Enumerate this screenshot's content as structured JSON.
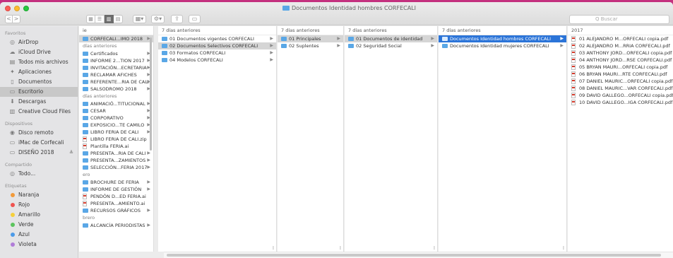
{
  "window": {
    "title": "Documentos Identidad hombres CORFECALI",
    "search_placeholder": "Q Buscar"
  },
  "toolbar": {
    "back_label": "<",
    "forward_label": ">",
    "view_icons": [
      "▦",
      "☰",
      "▥",
      "▤"
    ],
    "group_label": "▦▾",
    "action_label": "⚙▾",
    "share_label": "⇪",
    "tag_label": "▭"
  },
  "sidebar": {
    "favorites_header": "Favoritos",
    "favorites": [
      {
        "label": "AirDrop",
        "icon": "airdrop-icon",
        "glyph": "◎"
      },
      {
        "label": "iCloud Drive",
        "icon": "cloud-icon",
        "glyph": "☁"
      },
      {
        "label": "Todos mis archivos",
        "icon": "all-files-icon",
        "glyph": "▤"
      },
      {
        "label": "Aplicaciones",
        "icon": "applications-icon",
        "glyph": "✦"
      },
      {
        "label": "Documentos",
        "icon": "documents-icon",
        "glyph": "▯"
      },
      {
        "label": "Escritorio",
        "icon": "desktop-icon",
        "glyph": "▭",
        "selected": true
      },
      {
        "label": "Descargas",
        "icon": "downloads-icon",
        "glyph": "⬇"
      },
      {
        "label": "Creative Cloud Files",
        "icon": "creative-cloud-icon",
        "glyph": "▥"
      }
    ],
    "devices_header": "Dispositivos",
    "devices": [
      {
        "label": "Disco remoto",
        "icon": "remote-disc-icon",
        "glyph": "◉"
      },
      {
        "label": "iMac de Corfecali",
        "icon": "imac-icon",
        "glyph": "▭"
      },
      {
        "label": "DISEÑO 2018",
        "icon": "drive-icon",
        "glyph": "▭",
        "eject": "≜"
      }
    ],
    "shared_header": "Compartido",
    "shared": [
      {
        "label": "Todo...",
        "icon": "network-icon",
        "glyph": "◎"
      }
    ],
    "tags_header": "Etiquetas",
    "tags": [
      {
        "label": "Naranja",
        "color": "#f29a3a"
      },
      {
        "label": "Rojo",
        "color": "#ef5350"
      },
      {
        "label": "Amarillo",
        "color": "#f5cf3b"
      },
      {
        "label": "Verde",
        "color": "#5cc45e"
      },
      {
        "label": "Azul",
        "color": "#4c9ae8"
      },
      {
        "label": "Violeta",
        "color": "#b07cd8"
      }
    ]
  },
  "columns": {
    "c1": {
      "header": "ie",
      "groups": [
        {
          "header": "",
          "rows": [
            {
              "label": "CORFECALI...IMO 2018",
              "arrow": true,
              "icon": "folder",
              "selected": "gray"
            }
          ]
        },
        {
          "header": "días anteriores",
          "rows": [
            {
              "label": "Certificados",
              "arrow": true,
              "icon": "folder"
            },
            {
              "label": "INFORME 2...TION 2017",
              "arrow": true,
              "icon": "folder"
            },
            {
              "label": "INVITACIÓN...ECRETARIA",
              "arrow": true,
              "icon": "folder"
            },
            {
              "label": "RECLAMAR AFICHES",
              "arrow": true,
              "icon": "folder"
            },
            {
              "label": "REFERENTE...RIA DE CALI",
              "arrow": true,
              "icon": "folder"
            },
            {
              "label": "SALSODROMO 2018",
              "arrow": true,
              "icon": "folder"
            }
          ]
        },
        {
          "header": "días anteriores",
          "rows": [
            {
              "label": "ANIMACIÓ...TITUCIONAL",
              "arrow": true,
              "icon": "folder"
            },
            {
              "label": "CESAR",
              "arrow": true,
              "icon": "folder"
            },
            {
              "label": "CORPORATIVO",
              "arrow": true,
              "icon": "folder"
            },
            {
              "label": "EXPOSICIO...TE CAMILO",
              "arrow": true,
              "icon": "folder"
            },
            {
              "label": "LIBRO FERIA DE CALI",
              "arrow": true,
              "icon": "folder"
            },
            {
              "label": "LIBRO FERIA DE CALI.zip",
              "arrow": false,
              "icon": "file"
            },
            {
              "label": "Plantilla FERIA.ai",
              "arrow": false,
              "icon": "file"
            },
            {
              "label": "PRESENTA...RIA DE CALI",
              "arrow": true,
              "icon": "folder"
            },
            {
              "label": "PRESENTA...ZAMIENTOS",
              "arrow": true,
              "icon": "folder"
            },
            {
              "label": "SELECCIÓN...FERIA 2017",
              "arrow": true,
              "icon": "folder"
            }
          ]
        },
        {
          "header": "ero",
          "rows": [
            {
              "label": "BROCHURE DE FERIA",
              "arrow": true,
              "icon": "folder"
            },
            {
              "label": "INFORME DE GESTIÓN",
              "arrow": true,
              "icon": "folder"
            },
            {
              "label": "PENDÓN D...ED FERIA.ai",
              "arrow": false,
              "icon": "file"
            },
            {
              "label": "PRESENTA...AMIENTO.ai",
              "arrow": false,
              "icon": "file"
            },
            {
              "label": "RECURSOS GRÁFICOS",
              "arrow": true,
              "icon": "folder"
            }
          ]
        },
        {
          "header": "brero",
          "rows": [
            {
              "label": "ALCANCÍA PERIODISTAS",
              "arrow": true,
              "icon": "folder"
            }
          ]
        }
      ]
    },
    "c2": {
      "header": "7 días anteriores",
      "rows": [
        {
          "label": "01 Documentos vigentes CORFECALI",
          "arrow": true
        },
        {
          "label": "02 Documentos Selectivos CORFECALI",
          "arrow": true,
          "selected": "gray"
        },
        {
          "label": "03 Formatos CORFECALI",
          "arrow": true
        },
        {
          "label": "04 Modelos CORFECALI",
          "arrow": true
        }
      ]
    },
    "c3": {
      "header": "7 días anteriores",
      "rows": [
        {
          "label": "01 Principales",
          "arrow": true,
          "selected": "gray"
        },
        {
          "label": "02 Suplentes",
          "arrow": true
        }
      ]
    },
    "c4": {
      "header": "7 días anteriores",
      "rows": [
        {
          "label": "01 Documentos de identidad",
          "arrow": true,
          "selected": "gray"
        },
        {
          "label": "02 Seguridad Social",
          "arrow": true
        }
      ]
    },
    "c5": {
      "header": "7 días anteriores",
      "rows": [
        {
          "label": "Documentos Identidad hombres CORFECALI",
          "arrow": true,
          "selected": "blue"
        },
        {
          "label": "Documentos Identidad mujeres CORFECALI",
          "arrow": true
        }
      ]
    },
    "c6": {
      "header": "2017",
      "rows": [
        {
          "label": "01 ALEJANDRO M...ORFECALI copia.pdf"
        },
        {
          "label": "02 ALEJANDRO M...RRIA CORFECALI.pdf"
        },
        {
          "label": "03 ANTHONY JORD...ORFECALI copia.pdf"
        },
        {
          "label": "04 ANTHONY JORD...RSE CORFECALI.pdf"
        },
        {
          "label": "05 BRYAN MAURI...ORFECALI copia.pdf"
        },
        {
          "label": "06 BRYAN MAURI...RTE CORFECALI.pdf"
        },
        {
          "label": "07 DANIEL MAURIC...ORFECALI copia.pdf"
        },
        {
          "label": "08 DANIEL MAURIC...VAR CORFECALI.pdf"
        },
        {
          "label": "09 DAVID GALLEGO...ORFECALI copia.pdf"
        },
        {
          "label": "10 DAVID GALLEGO...IGA CORFECALI.pdf"
        }
      ]
    }
  }
}
